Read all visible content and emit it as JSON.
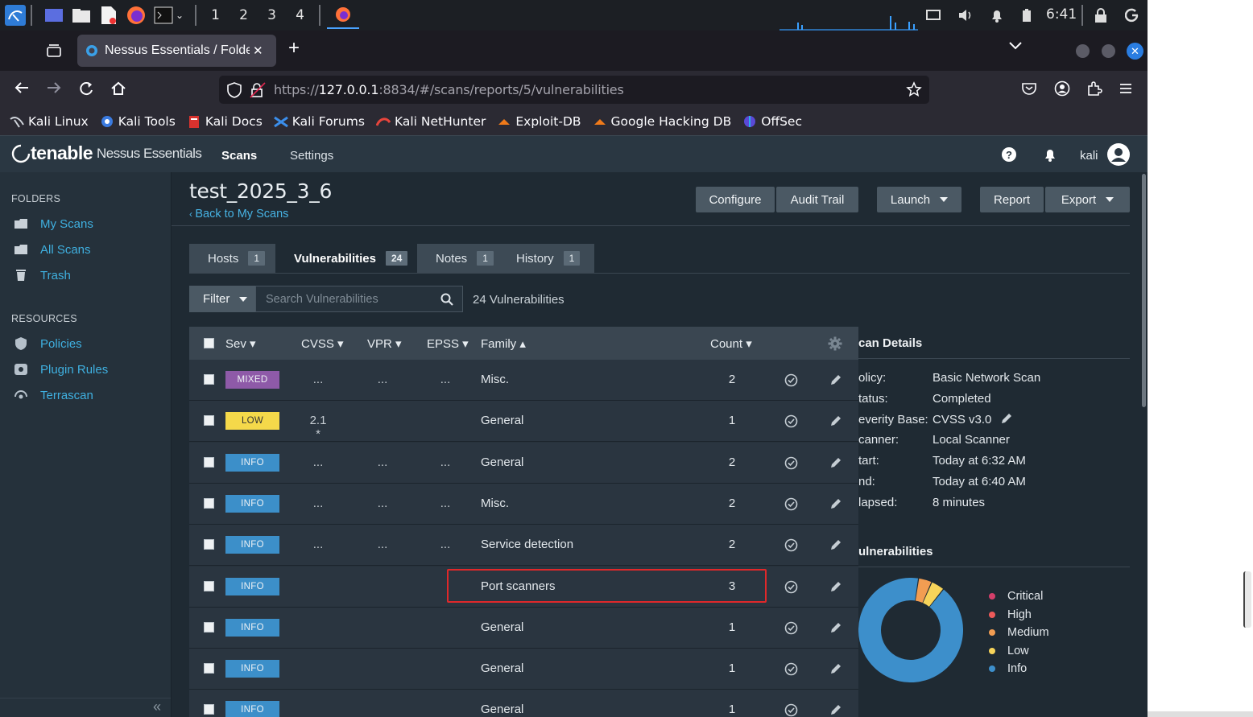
{
  "taskbar": {
    "workspaces": [
      "1",
      "2",
      "3",
      "4"
    ],
    "clock": "6:41"
  },
  "browser": {
    "tab_title": "Nessus Essentials / Folde",
    "new_tab": "+",
    "url_prefix": "https://",
    "url_host": "127.0.0.1",
    "url_rest": ":8834/#/scans/reports/5/vulnerabilities",
    "bookmarks": [
      "Kali Linux",
      "Kali Tools",
      "Kali Docs",
      "Kali Forums",
      "Kali NetHunter",
      "Exploit-DB",
      "Google Hacking DB",
      "OffSec"
    ]
  },
  "header": {
    "logo_brand": "tenable",
    "logo_product": "Nessus Essentials",
    "nav_scans": "Scans",
    "nav_settings": "Settings",
    "user": "kali"
  },
  "sidebar": {
    "folders_heading": "FOLDERS",
    "folders": [
      {
        "label": "My Scans",
        "icon": "folder-icon"
      },
      {
        "label": "All Scans",
        "icon": "folder-icon"
      },
      {
        "label": "Trash",
        "icon": "trash-icon"
      }
    ],
    "resources_heading": "RESOURCES",
    "resources": [
      {
        "label": "Policies",
        "icon": "shield-icon"
      },
      {
        "label": "Plugin Rules",
        "icon": "plugin-icon"
      },
      {
        "label": "Terrascan",
        "icon": "terrascan-icon"
      }
    ],
    "collapse": "«"
  },
  "scan": {
    "title": "test_2025_3_6",
    "back_link": "Back to My Scans",
    "buttons": {
      "configure": "Configure",
      "audit_trail": "Audit Trail",
      "launch": "Launch",
      "report": "Report",
      "export": "Export"
    }
  },
  "tabs": [
    {
      "label": "Hosts",
      "count": "1"
    },
    {
      "label": "Vulnerabilities",
      "count": "24"
    },
    {
      "label": "Notes",
      "count": "1"
    },
    {
      "label": "History",
      "count": "1"
    }
  ],
  "filter": {
    "label": "Filter",
    "search_placeholder": "Search Vulnerabilities",
    "result_count": "24 Vulnerabilities"
  },
  "table": {
    "columns": {
      "sev": "Sev ▾",
      "cvss": "CVSS ▾",
      "vpr": "VPR ▾",
      "epss": "EPSS ▾",
      "family": "Family ▴",
      "count": "Count ▾"
    },
    "rows": [
      {
        "sev": "MIXED",
        "cvss": "...",
        "vpr": "...",
        "epss": "...",
        "family": "Misc.",
        "count": "2"
      },
      {
        "sev": "LOW",
        "cvss": "2.1 *",
        "vpr": "",
        "epss": "",
        "family": "General",
        "count": "1"
      },
      {
        "sev": "INFO",
        "cvss": "...",
        "vpr": "...",
        "epss": "...",
        "family": "General",
        "count": "2"
      },
      {
        "sev": "INFO",
        "cvss": "...",
        "vpr": "...",
        "epss": "...",
        "family": "Misc.",
        "count": "2"
      },
      {
        "sev": "INFO",
        "cvss": "...",
        "vpr": "...",
        "epss": "...",
        "family": "Service detection",
        "count": "2"
      },
      {
        "sev": "INFO",
        "cvss": "",
        "vpr": "",
        "epss": "",
        "family": "Port scanners",
        "count": "3"
      },
      {
        "sev": "INFO",
        "cvss": "",
        "vpr": "",
        "epss": "",
        "family": "General",
        "count": "1"
      },
      {
        "sev": "INFO",
        "cvss": "",
        "vpr": "",
        "epss": "",
        "family": "General",
        "count": "1"
      },
      {
        "sev": "INFO",
        "cvss": "",
        "vpr": "",
        "epss": "",
        "family": "General",
        "count": "1"
      }
    ],
    "sev_colors": {
      "MIXED": "#8e5aa8",
      "LOW": "#f5d94a",
      "INFO": "#3c8fc9"
    }
  },
  "details": {
    "heading": "can Details",
    "items": [
      {
        "label": "olicy:",
        "value": "Basic Network Scan"
      },
      {
        "label": "tatus:",
        "value": "Completed"
      },
      {
        "label": "everity Base:",
        "value": "CVSS v3.0"
      },
      {
        "label": "canner:",
        "value": "Local Scanner"
      },
      {
        "label": "tart:",
        "value": "Today at 6:32 AM"
      },
      {
        "label": "nd:",
        "value": "Today at 6:40 AM"
      },
      {
        "label": "lapsed:",
        "value": "8 minutes"
      }
    ],
    "vuln_heading": "ulnerabilities",
    "legend": [
      {
        "label": "Critical",
        "color": "#d43f6a"
      },
      {
        "label": "High",
        "color": "#ee5a5a"
      },
      {
        "label": "Medium",
        "color": "#f29d52"
      },
      {
        "label": "Low",
        "color": "#f7d45a"
      },
      {
        "label": "Info",
        "color": "#3d8fcb"
      }
    ],
    "donut": {
      "medium": 1,
      "low": 1,
      "info": 22
    }
  }
}
